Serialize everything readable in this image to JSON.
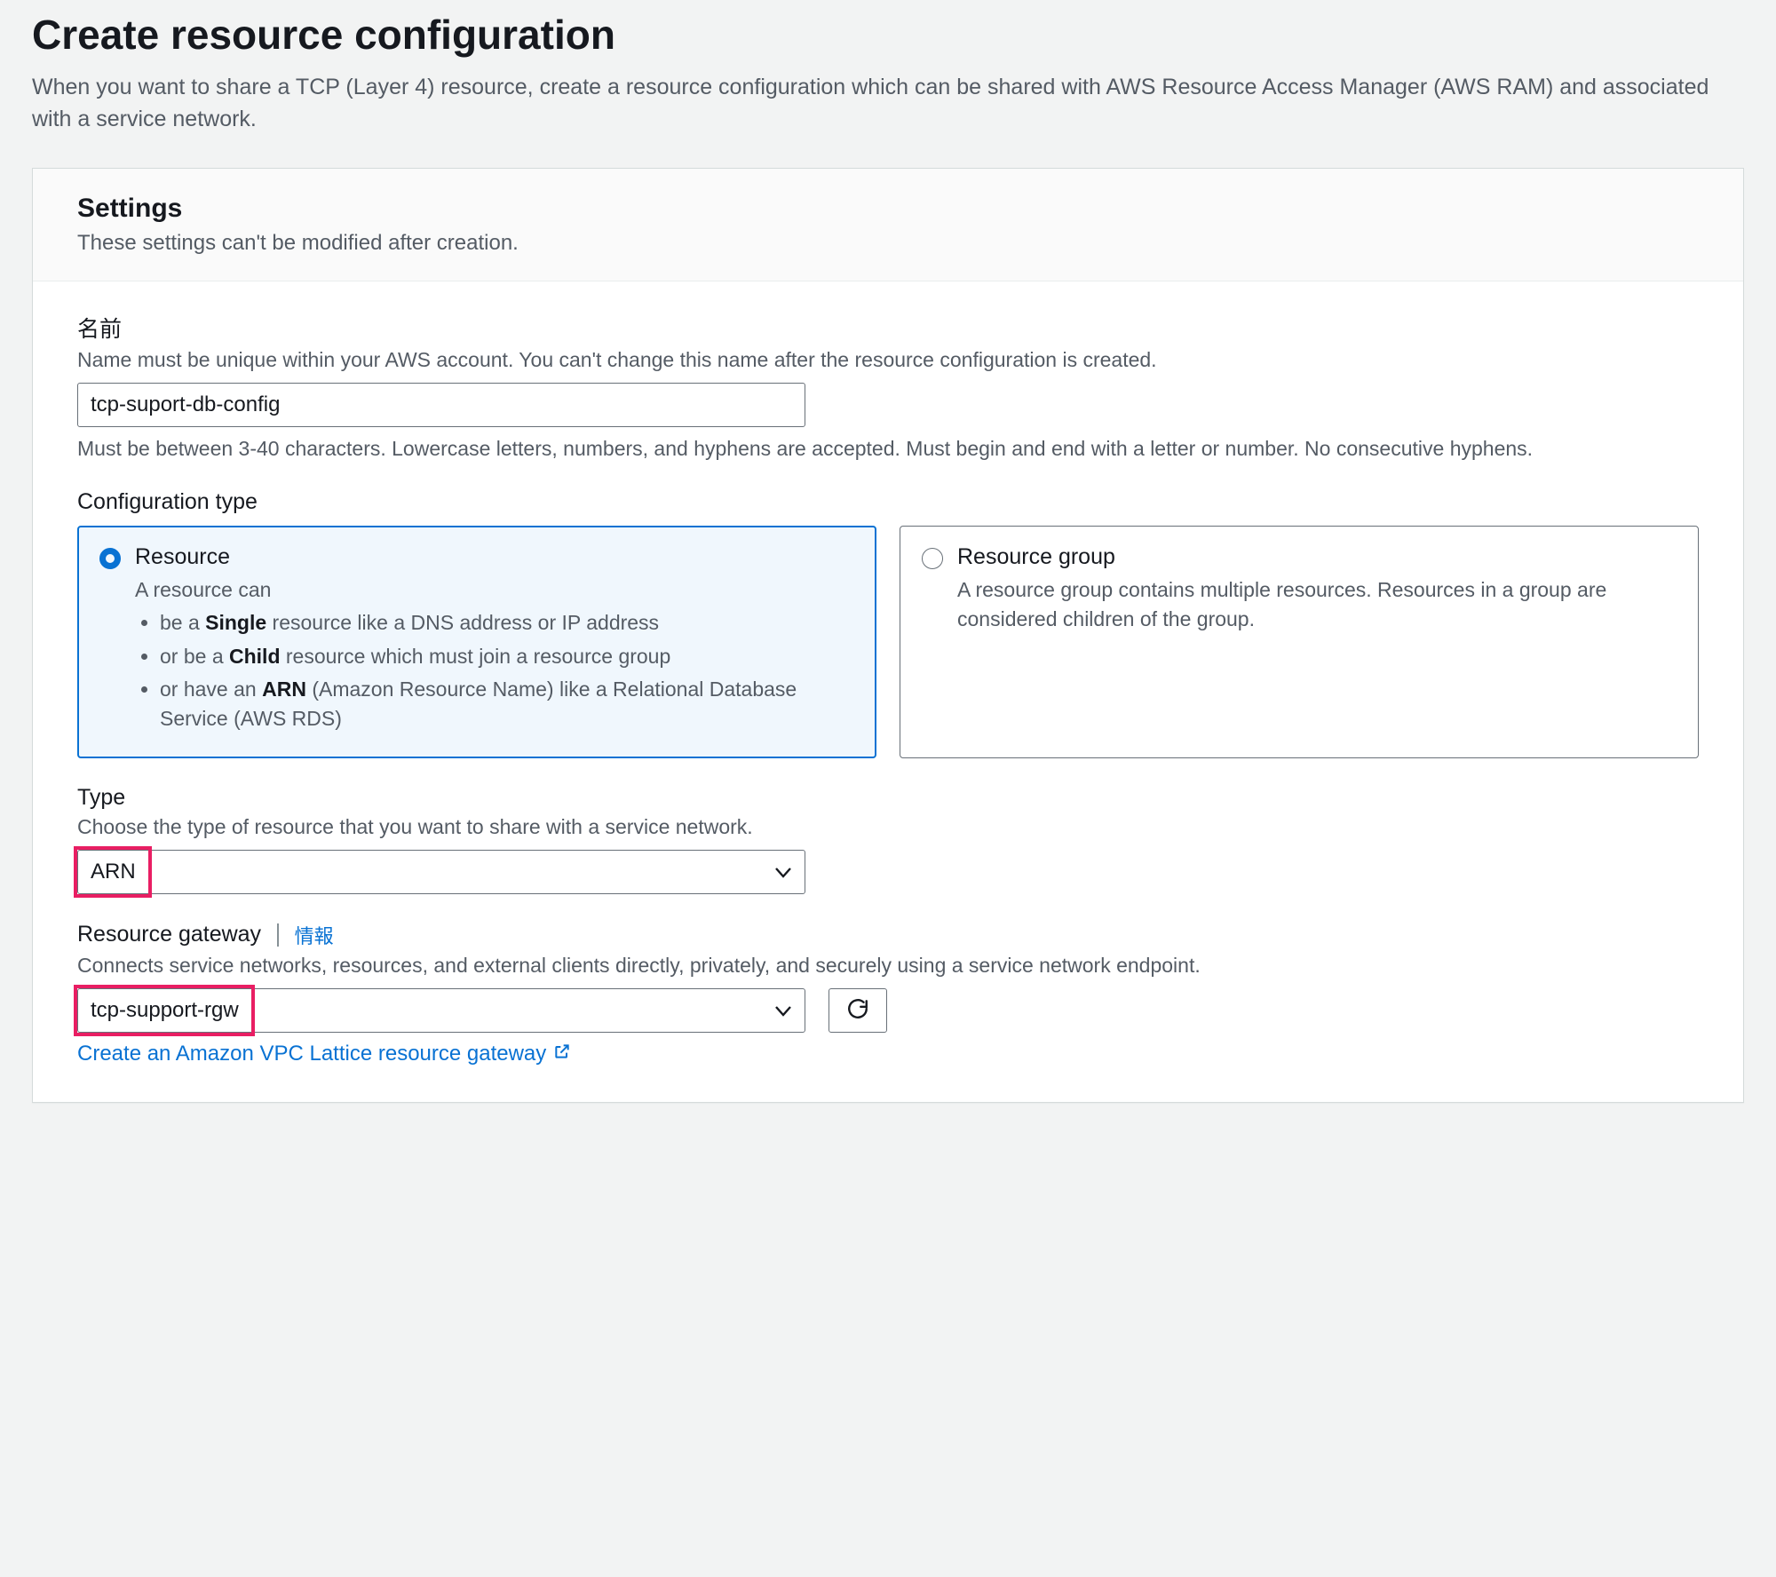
{
  "page": {
    "title": "Create resource configuration",
    "subtitle": "When you want to share a TCP (Layer 4) resource, create a resource configuration which can be shared with AWS Resource Access Manager (AWS RAM) and associated with a service network."
  },
  "settings": {
    "heading": "Settings",
    "subheading": "These settings can't be modified after creation."
  },
  "name_field": {
    "label": "名前",
    "desc": "Name must be unique within your AWS account. You can't change this name after the resource configuration is created.",
    "value": "tcp-suport-db-config",
    "hint": "Must be between 3-40 characters. Lowercase letters, numbers, and hyphens are accepted. Must begin and end with a letter or number. No consecutive hyphens."
  },
  "config_type": {
    "label": "Configuration type",
    "options": {
      "resource": {
        "title": "Resource",
        "intro": "A resource can",
        "bullet1_pre": "be a ",
        "bullet1_bold": "Single",
        "bullet1_post": " resource like a DNS address or IP address",
        "bullet2_pre": "or be a ",
        "bullet2_bold": "Child",
        "bullet2_post": " resource which must join a resource group",
        "bullet3_pre": "or have an ",
        "bullet3_bold": "ARN",
        "bullet3_post": " (Amazon Resource Name) like a Relational Database Service (AWS RDS)"
      },
      "resource_group": {
        "title": "Resource group",
        "desc": "A resource group contains multiple resources. Resources in a group are considered children of the group."
      }
    },
    "selected": "resource"
  },
  "type_field": {
    "label": "Type",
    "desc": "Choose the type of resource that you want to share with a service network.",
    "selected": "ARN"
  },
  "gateway_field": {
    "label": "Resource gateway",
    "info_link": "情報",
    "desc": "Connects service networks, resources, and external clients directly, privately, and securely using a service network endpoint.",
    "selected": "tcp-support-rgw",
    "create_link": "Create an Amazon VPC Lattice resource gateway"
  }
}
